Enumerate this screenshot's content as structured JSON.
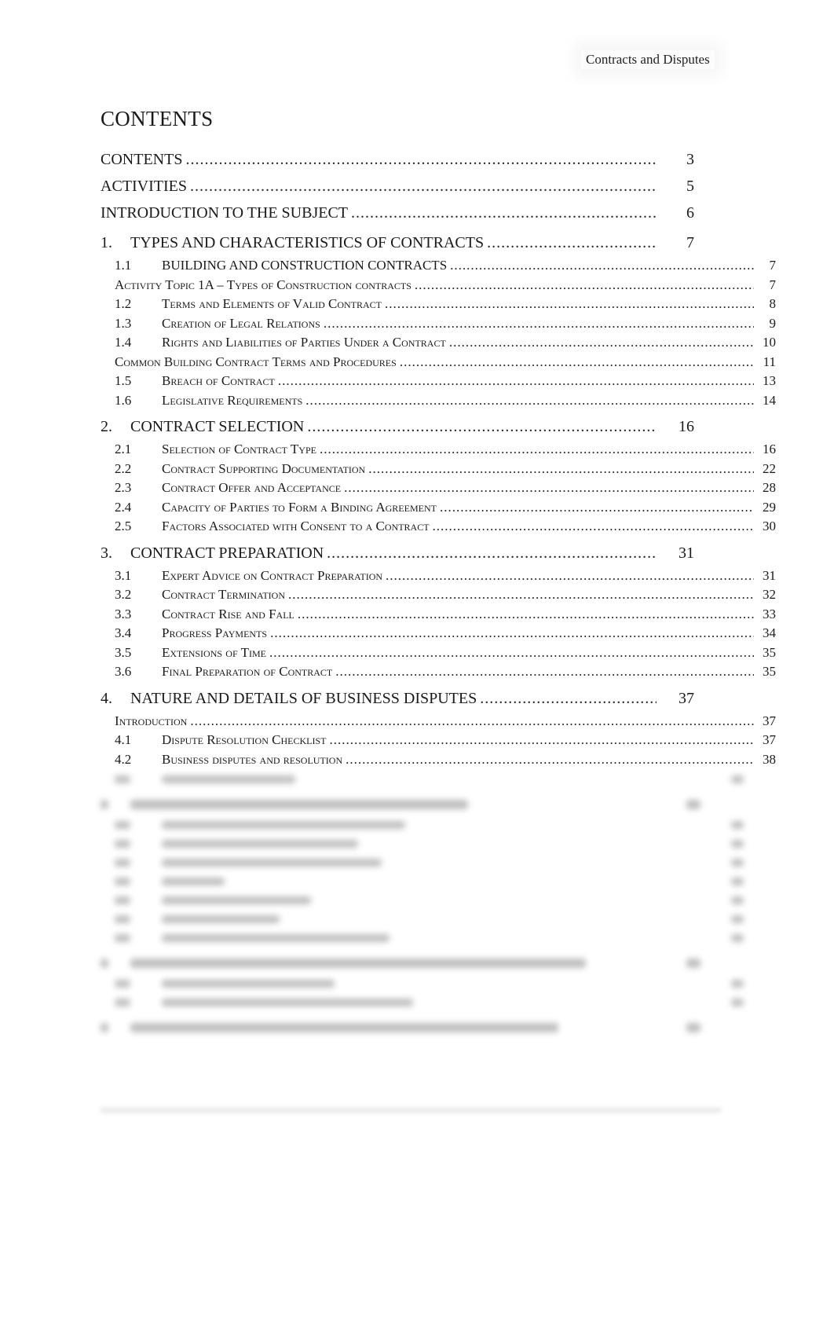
{
  "header": {
    "running_title": "Contracts and Disputes"
  },
  "title": "CONTENTS",
  "toc": {
    "top": [
      {
        "label": "CONTENTS",
        "page": "3"
      },
      {
        "label": "ACTIVITIES",
        "page": "5"
      },
      {
        "label": "INTRODUCTION TO THE SUBJECT",
        "page": "6"
      }
    ],
    "sections": [
      {
        "number": "1.",
        "label": "TYPES AND CHARACTERISTICS OF CONTRACTS",
        "page": "7",
        "items": [
          {
            "number": "1.1",
            "label": "BUILDING AND CONSTRUCTION CONTRACTS",
            "page": "7"
          },
          {
            "number": "",
            "label": "Activity Topic 1A – Types of Construction contracts",
            "page": "7"
          },
          {
            "number": "1.2",
            "label": "Terms and Elements of Valid Contract",
            "page": "8"
          },
          {
            "number": "1.3",
            "label": "Creation of Legal Relations",
            "page": "9"
          },
          {
            "number": "1.4",
            "label": "Rights and Liabilities of Parties Under a Contract",
            "page": "10"
          },
          {
            "number": "",
            "label": "Common Building Contract Terms and Procedures",
            "page": "11"
          },
          {
            "number": "1.5",
            "label": "Breach of Contract",
            "page": "13"
          },
          {
            "number": "1.6",
            "label": "Legislative Requirements",
            "page": "14"
          }
        ]
      },
      {
        "number": "2.",
        "label": "CONTRACT SELECTION",
        "page": "16",
        "items": [
          {
            "number": "2.1",
            "label": "Selection of Contract Type",
            "page": "16"
          },
          {
            "number": "2.2",
            "label": "Contract Supporting Documentation",
            "page": "22"
          },
          {
            "number": "2.3",
            "label": "Contract Offer and Acceptance",
            "page": "28"
          },
          {
            "number": "2.4",
            "label": "Capacity of Parties to Form a Binding Agreement",
            "page": "29"
          },
          {
            "number": "2.5",
            "label": "Factors Associated with Consent to a Contract",
            "page": "30"
          }
        ]
      },
      {
        "number": "3.",
        "label": "CONTRACT PREPARATION",
        "page": "31",
        "items": [
          {
            "number": "3.1",
            "label": "Expert Advice on Contract Preparation",
            "page": "31"
          },
          {
            "number": "3.2",
            "label": "Contract Termination",
            "page": "32"
          },
          {
            "number": "3.3",
            "label": "Contract Rise and Fall",
            "page": "33"
          },
          {
            "number": "3.4",
            "label": "Progress Payments",
            "page": "34"
          },
          {
            "number": "3.5",
            "label": "Extensions of Time",
            "page": "35"
          },
          {
            "number": "3.6",
            "label": "Final Preparation of Contract",
            "page": "35"
          }
        ]
      },
      {
        "number": "4.",
        "label": "NATURE AND DETAILS OF BUSINESS DISPUTES",
        "page": "37",
        "items": [
          {
            "number": "",
            "label": "Introduction",
            "page": "37"
          },
          {
            "number": "4.1",
            "label": "Dispute Resolution Checklist",
            "page": "37"
          },
          {
            "number": "4.2",
            "label": "Business disputes and resolution",
            "page": "38"
          }
        ]
      }
    ]
  }
}
